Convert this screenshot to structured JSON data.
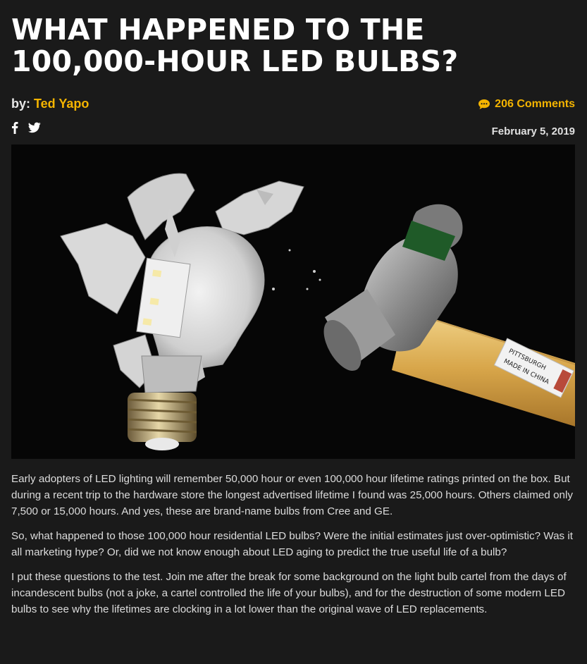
{
  "article": {
    "title": "WHAT HAPPENED TO THE 100,000-HOUR LED BULBS?",
    "byline_prefix": "by:",
    "author": "Ted Yapo",
    "comments_label": "206 Comments",
    "date": "February 5, 2019",
    "social": [
      {
        "name": "facebook-icon",
        "glyph": "f"
      },
      {
        "name": "twitter-icon"
      }
    ],
    "hero_image": {
      "label_line1": "PITTSBURGH",
      "label_line2": "MADE IN CHINA",
      "alt_icon": "shattered-led-bulb-and-hammer-image"
    },
    "paragraphs": [
      "Early adopters of LED lighting will remember 50,000 hour or even 100,000 hour lifetime ratings printed on the box. But during a recent trip to the hardware store the longest advertised lifetime I found was 25,000 hours. Others claimed only 7,500 or 15,000 hours. And yes, these are brand-name bulbs from Cree and GE.",
      "So, what happened to those 100,000 hour residential LED bulbs? Were the initial estimates just over-optimistic? Was it all marketing hype? Or, did we not know enough about LED aging to predict the true useful life of a bulb?",
      "I put these questions to the test. Join me after the break for some background on the light bulb cartel from the days of incandescent bulbs (not a joke, a cartel controlled the life of your bulbs), and for the destruction of some modern LED bulbs to see why the lifetimes are clocking in a lot lower than the original wave of LED replacements."
    ]
  },
  "colors": {
    "background": "#1a1a1a",
    "accent": "#f4b400",
    "title": "#ffffff",
    "text": "#dcdcdc"
  }
}
